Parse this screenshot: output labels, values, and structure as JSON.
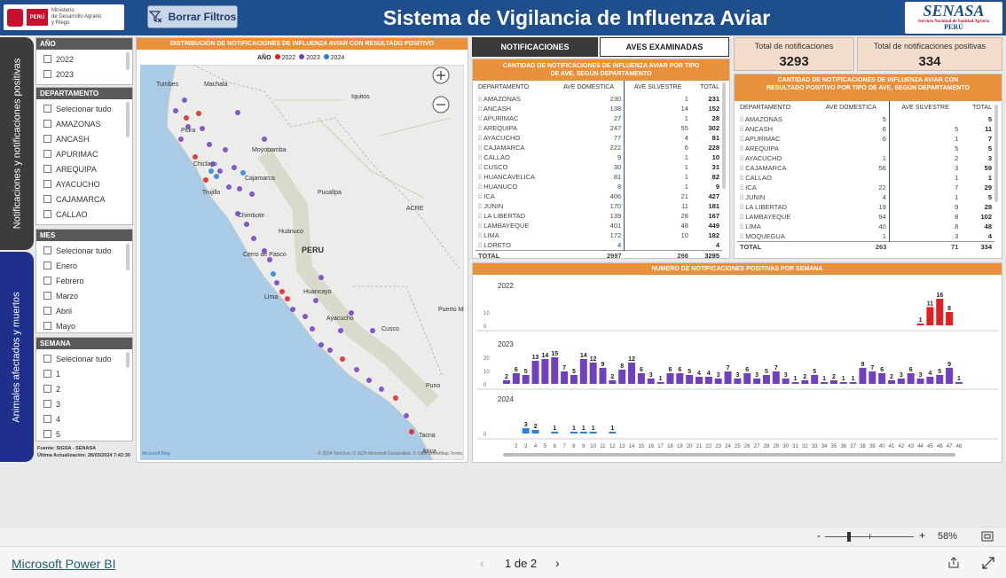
{
  "header": {
    "title": "Sistema de Vigilancia de Influenza Aviar",
    "clear_button": "Borrar Filtros",
    "ministry_logo": {
      "flag": "PERÚ",
      "line1": "Ministerio",
      "line2": "de Desarrollo Agrario",
      "line3": "y Riego"
    },
    "senasa_logo": {
      "name": "SENASA",
      "subtitle": "Servicio Nacional de Sanidad Agraria",
      "country": "PERÚ"
    }
  },
  "side_tabs": [
    "Notificaciones y notificaciones positivas",
    "Animales afectados y muertos"
  ],
  "filters": {
    "year": {
      "title": "AÑO",
      "items": [
        "2022",
        "2023"
      ]
    },
    "department": {
      "title": "DEPARTAMENTO",
      "items": [
        "Selecionar tudo",
        "AMAZONAS",
        "ANCASH",
        "APURIMAC",
        "AREQUIPA",
        "AYACUCHO",
        "CAJAMARCA",
        "CALLAO"
      ]
    },
    "month": {
      "title": "MES",
      "items": [
        "Selecionar tudo",
        "Enero",
        "Febrero",
        "Marzo",
        "Abril",
        "Mayo"
      ]
    },
    "week": {
      "title": "SEMANA",
      "items": [
        "Selecionar tudo",
        "1",
        "2",
        "3",
        "4",
        "5"
      ]
    },
    "source": "Fuente: SIGSA - SENASA",
    "last_update": "Última Actualización:  26/03/2024  7:42:30"
  },
  "map": {
    "title": "DISTRIBUCIÓN DE NOTIFICACIONES DE INFLUENZA AVIAR CON RESULTADO POSITIVO",
    "legend_title": "AÑO",
    "legend": [
      {
        "label": "2022",
        "color": "#e02020"
      },
      {
        "label": "2023",
        "color": "#7040c0"
      },
      {
        "label": "2024",
        "color": "#2a7de1"
      }
    ],
    "places": [
      "Tumbes",
      "Machala",
      "Iquitos",
      "Piura",
      "Moyobamba",
      "Chiclayo",
      "Cajamarca",
      "Trujillo",
      "Pucallpa",
      "ACRE",
      "Chimbote",
      "Huánuco",
      "PERU",
      "Cerro de Pasco",
      "Huancayo",
      "Lima",
      "Puerto Maldonado",
      "Ayacucho",
      "Cusco",
      "Puno",
      "Tacna",
      "Arica"
    ],
    "attribution": "© 2024 TomTom, © 2024 Microsoft Corporation, © OpenStreetMap  Terms",
    "brand": "Microsoft Bing"
  },
  "tabs": {
    "notifications": "NOTIFICACIONES",
    "birds": "AVES EXAMINADAS"
  },
  "table1": {
    "title": "CANTIDAD DE NOTIFICACIONES DE INFLUENZA AVIAR POR TIPO DE AVE, SEGÚN DEPARTAMENTO",
    "headers": [
      "DEPARTAMENTO",
      "AVE DOMESTICA",
      "AVE SILVESTRE",
      "TOTAL"
    ],
    "rows": [
      [
        "AMAZONAS",
        "230",
        "1",
        "231"
      ],
      [
        "ANCASH",
        "138",
        "14",
        "152"
      ],
      [
        "APURIMAC",
        "27",
        "1",
        "28"
      ],
      [
        "AREQUIPA",
        "247",
        "55",
        "302"
      ],
      [
        "AYACUCHO",
        "77",
        "4",
        "81"
      ],
      [
        "CAJAMARCA",
        "222",
        "6",
        "228"
      ],
      [
        "CALLAO",
        "9",
        "1",
        "10"
      ],
      [
        "CUSCO",
        "30",
        "1",
        "31"
      ],
      [
        "HUANCAVELICA",
        "81",
        "1",
        "82"
      ],
      [
        "HUANUCO",
        "8",
        "1",
        "9"
      ],
      [
        "ICA",
        "406",
        "21",
        "427"
      ],
      [
        "JUNIN",
        "170",
        "11",
        "181"
      ],
      [
        "LA LIBERTAD",
        "139",
        "28",
        "167"
      ],
      [
        "LAMBAYEQUE",
        "401",
        "48",
        "449"
      ],
      [
        "LIMA",
        "172",
        "10",
        "182"
      ],
      [
        "LORETO",
        "4",
        "",
        "4"
      ]
    ],
    "total": [
      "TOTAL",
      "2997",
      "298",
      "3295"
    ]
  },
  "kpis": [
    {
      "label": "Total de notificaciones",
      "value": "3293"
    },
    {
      "label": "Total de notificaciones positivas",
      "value": "334"
    }
  ],
  "table2": {
    "title": "CANTIDAD DE NOTIFICACIONES DE INFLUENZA AVIAR CON RESULTADO POSITIVO POR TIPO DE AVE, SEGÚN DEPARTAMENTO",
    "headers": [
      "DEPARTAMENTO",
      "AVE DOMESTICA",
      "AVE SILVESTRE",
      "TOTAL"
    ],
    "rows": [
      [
        "AMAZONAS",
        "5",
        "",
        "5"
      ],
      [
        "ANCASH",
        "6",
        "5",
        "11"
      ],
      [
        "APURIMAC",
        "6",
        "1",
        "7"
      ],
      [
        "AREQUIPA",
        "",
        "5",
        "5"
      ],
      [
        "AYACUCHO",
        "1",
        "2",
        "3"
      ],
      [
        "CAJAMARCA",
        "56",
        "3",
        "59"
      ],
      [
        "CALLAO",
        "",
        "1",
        "1"
      ],
      [
        "ICA",
        "22",
        "7",
        "29"
      ],
      [
        "JUNIN",
        "4",
        "1",
        "5"
      ],
      [
        "LA LIBERTAD",
        "19",
        "9",
        "28"
      ],
      [
        "LAMBAYEQUE",
        "94",
        "8",
        "102"
      ],
      [
        "LIMA",
        "40",
        "8",
        "48"
      ],
      [
        "MOQUEGUA",
        "1",
        "3",
        "4"
      ]
    ],
    "total": [
      "TOTAL",
      "263",
      "71",
      "334"
    ]
  },
  "chart_data": {
    "type": "bar",
    "title": "NUMERO DE NOTIFICACIONES POSITIVAS POR SEMANA",
    "xlabel": "",
    "x": [
      1,
      2,
      3,
      4,
      5,
      6,
      7,
      8,
      9,
      10,
      11,
      12,
      13,
      14,
      15,
      16,
      17,
      18,
      19,
      20,
      21,
      22,
      23,
      24,
      25,
      26,
      27,
      28,
      29,
      30,
      31,
      32,
      33,
      34,
      35,
      36,
      37,
      38,
      39,
      40,
      41,
      42,
      43,
      44,
      45,
      46,
      47,
      48
    ],
    "x_tick_labels": [
      "2",
      "3",
      "4",
      "5",
      "6",
      "7",
      "8",
      "9",
      "10",
      "11",
      "12",
      "13",
      "14",
      "15",
      "16",
      "17",
      "18",
      "19",
      "20",
      "21",
      "22",
      "23",
      "24",
      "25",
      "26",
      "27",
      "28",
      "29",
      "30",
      "31",
      "32",
      "33",
      "34",
      "35",
      "36",
      "37",
      "38",
      "39",
      "40",
      "41",
      "42",
      "43",
      "44",
      "45",
      "46",
      "47",
      "48"
    ],
    "panels": [
      {
        "name": "2022",
        "color": "#e02020",
        "ylim": [
          0,
          16
        ],
        "yticks": [
          0,
          10
        ],
        "points": [
          [
            44,
            1
          ],
          [
            45,
            11
          ],
          [
            46,
            16
          ],
          [
            47,
            8
          ]
        ]
      },
      {
        "name": "2023",
        "color": "#7040c0",
        "ylim": [
          0,
          15
        ],
        "yticks": [
          0,
          10,
          20
        ],
        "points": [
          [
            1,
            2
          ],
          [
            2,
            6
          ],
          [
            3,
            5
          ],
          [
            4,
            13
          ],
          [
            5,
            14
          ],
          [
            6,
            15
          ],
          [
            7,
            7
          ],
          [
            8,
            5
          ],
          [
            9,
            14
          ],
          [
            10,
            12
          ],
          [
            11,
            9
          ],
          [
            12,
            2
          ],
          [
            13,
            8
          ],
          [
            14,
            12
          ],
          [
            15,
            6
          ],
          [
            16,
            3
          ],
          [
            17,
            1
          ],
          [
            18,
            6
          ],
          [
            19,
            6
          ],
          [
            20,
            5
          ],
          [
            21,
            4
          ],
          [
            22,
            4
          ],
          [
            23,
            3
          ],
          [
            24,
            7
          ],
          [
            25,
            3
          ],
          [
            26,
            6
          ],
          [
            27,
            3
          ],
          [
            28,
            5
          ],
          [
            29,
            7
          ],
          [
            30,
            3
          ],
          [
            31,
            1
          ],
          [
            32,
            2
          ],
          [
            33,
            5
          ],
          [
            34,
            1
          ],
          [
            35,
            2
          ],
          [
            36,
            1
          ],
          [
            37,
            1
          ],
          [
            38,
            9
          ],
          [
            39,
            7
          ],
          [
            40,
            6
          ],
          [
            41,
            2
          ],
          [
            42,
            3
          ],
          [
            43,
            6
          ],
          [
            44,
            3
          ],
          [
            45,
            4
          ],
          [
            46,
            5
          ],
          [
            47,
            9
          ],
          [
            48,
            1
          ]
        ]
      },
      {
        "name": "2024",
        "color": "#2a7de1",
        "ylim": [
          0,
          15
        ],
        "yticks": [
          0
        ],
        "points": [
          [
            3,
            3
          ],
          [
            4,
            2
          ],
          [
            6,
            1
          ],
          [
            8,
            1
          ],
          [
            9,
            1
          ],
          [
            10,
            1
          ],
          [
            12,
            1
          ]
        ]
      }
    ]
  },
  "zoom": {
    "level": "58%",
    "minus": "-",
    "plus": "+"
  },
  "footer": {
    "brand": "Microsoft Power BI",
    "page": "1 de 2"
  }
}
